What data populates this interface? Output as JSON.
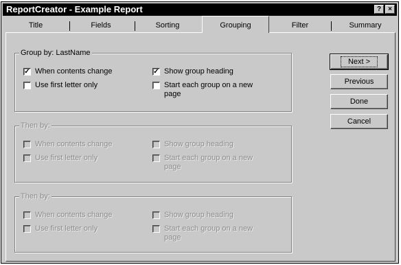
{
  "window": {
    "title": "ReportCreator - Example Report"
  },
  "title_buttons": {
    "help": "?",
    "close": "×"
  },
  "tabs": [
    "Title",
    "Fields",
    "Sorting",
    "Grouping",
    "Filter",
    "Summary"
  ],
  "active_tab": "Grouping",
  "groups": [
    {
      "label": "Group by: LastName",
      "enabled": true,
      "options": [
        {
          "label": "When contents change",
          "checked": true
        },
        {
          "label": "Use first letter only",
          "checked": false
        },
        {
          "label": "Show group heading",
          "checked": true
        },
        {
          "label": "Start each group on a new",
          "label2": "page",
          "checked": false
        }
      ]
    },
    {
      "label": "Then by:",
      "enabled": false,
      "options": [
        {
          "label": "When contents change",
          "checked": false
        },
        {
          "label": "Use first letter only",
          "checked": false
        },
        {
          "label": "Show group heading",
          "checked": false
        },
        {
          "label": "Start each group on a new",
          "label2": "page",
          "checked": false
        }
      ]
    },
    {
      "label": "Then by:",
      "enabled": false,
      "options": [
        {
          "label": "When contents change",
          "checked": false
        },
        {
          "label": "Use first letter only",
          "checked": false
        },
        {
          "label": "Show group heading",
          "checked": false
        },
        {
          "label": "Start each group on a new",
          "label2": "page",
          "checked": false
        }
      ]
    }
  ],
  "buttons": {
    "next": "Next >",
    "previous": "Previous",
    "done": "Done",
    "cancel": "Cancel"
  }
}
